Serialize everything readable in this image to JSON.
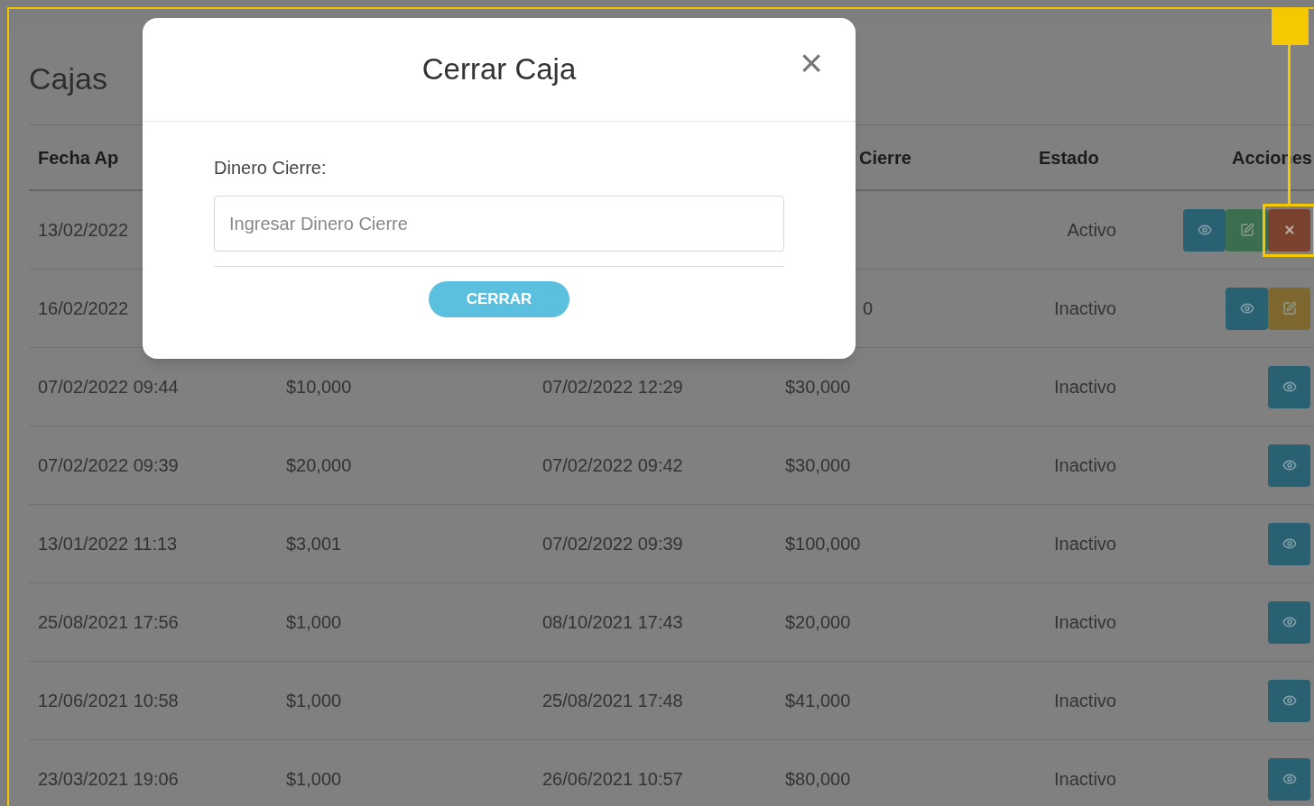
{
  "page": {
    "title": "Cajas"
  },
  "table": {
    "columns": [
      {
        "label": "Fecha Ap"
      },
      {},
      {},
      {
        "label": "Cierre"
      },
      {
        "label": "Estado"
      },
      {
        "label": "Acciones"
      }
    ],
    "rows": [
      {
        "cells": [
          "13/02/2022",
          null,
          null,
          null,
          "Activo"
        ],
        "actions": [
          {
            "kind": "view",
            "color": "#2a6172",
            "highlighted": false
          },
          {
            "kind": "edit",
            "color": "#3b6e4f",
            "highlighted": false
          },
          {
            "kind": "close",
            "color": "#7a412c",
            "highlighted": true
          }
        ]
      },
      {
        "cells": [
          "16/02/2022",
          null,
          null,
          "0",
          "Inactivo"
        ],
        "actions": [
          {
            "kind": "view",
            "color": "#2a6172",
            "highlighted": false
          },
          {
            "kind": "edit",
            "color": "#7f6830",
            "highlighted": false
          }
        ]
      },
      {
        "cells": [
          "07/02/2022 09:44",
          "$10,000",
          "07/02/2022 12:29",
          "$30,000",
          "Inactivo"
        ],
        "actions": [
          {
            "kind": "view",
            "color": "#2a6172",
            "highlighted": false
          }
        ]
      },
      {
        "cells": [
          "07/02/2022 09:39",
          "$20,000",
          "07/02/2022 09:42",
          "$30,000",
          "Inactivo"
        ],
        "actions": [
          {
            "kind": "view",
            "color": "#2a6172",
            "highlighted": false
          }
        ]
      },
      {
        "cells": [
          "13/01/2022 11:13",
          "$3,001",
          "07/02/2022 09:39",
          "$100,000",
          "Inactivo"
        ],
        "actions": [
          {
            "kind": "view",
            "color": "#2a6172",
            "highlighted": false
          }
        ]
      },
      {
        "cells": [
          "25/08/2021 17:56",
          "$1,000",
          "08/10/2021 17:43",
          "$20,000",
          "Inactivo"
        ],
        "actions": [
          {
            "kind": "view",
            "color": "#2a6172",
            "highlighted": false
          }
        ]
      },
      {
        "cells": [
          "12/06/2021 10:58",
          "$1,000",
          "25/08/2021 17:48",
          "$41,000",
          "Inactivo"
        ],
        "actions": [
          {
            "kind": "view",
            "color": "#2a6172",
            "highlighted": false
          }
        ]
      },
      {
        "cells": [
          "23/03/2021 19:06",
          "$1,000",
          "26/06/2021 10:57",
          "$80,000",
          "Inactivo"
        ],
        "actions": [
          {
            "kind": "view",
            "color": "#2a6172",
            "highlighted": false
          }
        ]
      }
    ]
  },
  "modal": {
    "title": "Cerrar Caja",
    "close": "×",
    "label": "Dinero Cierre:",
    "placeholder": "Ingresar Dinero Cierre",
    "button": "CERRAR"
  }
}
